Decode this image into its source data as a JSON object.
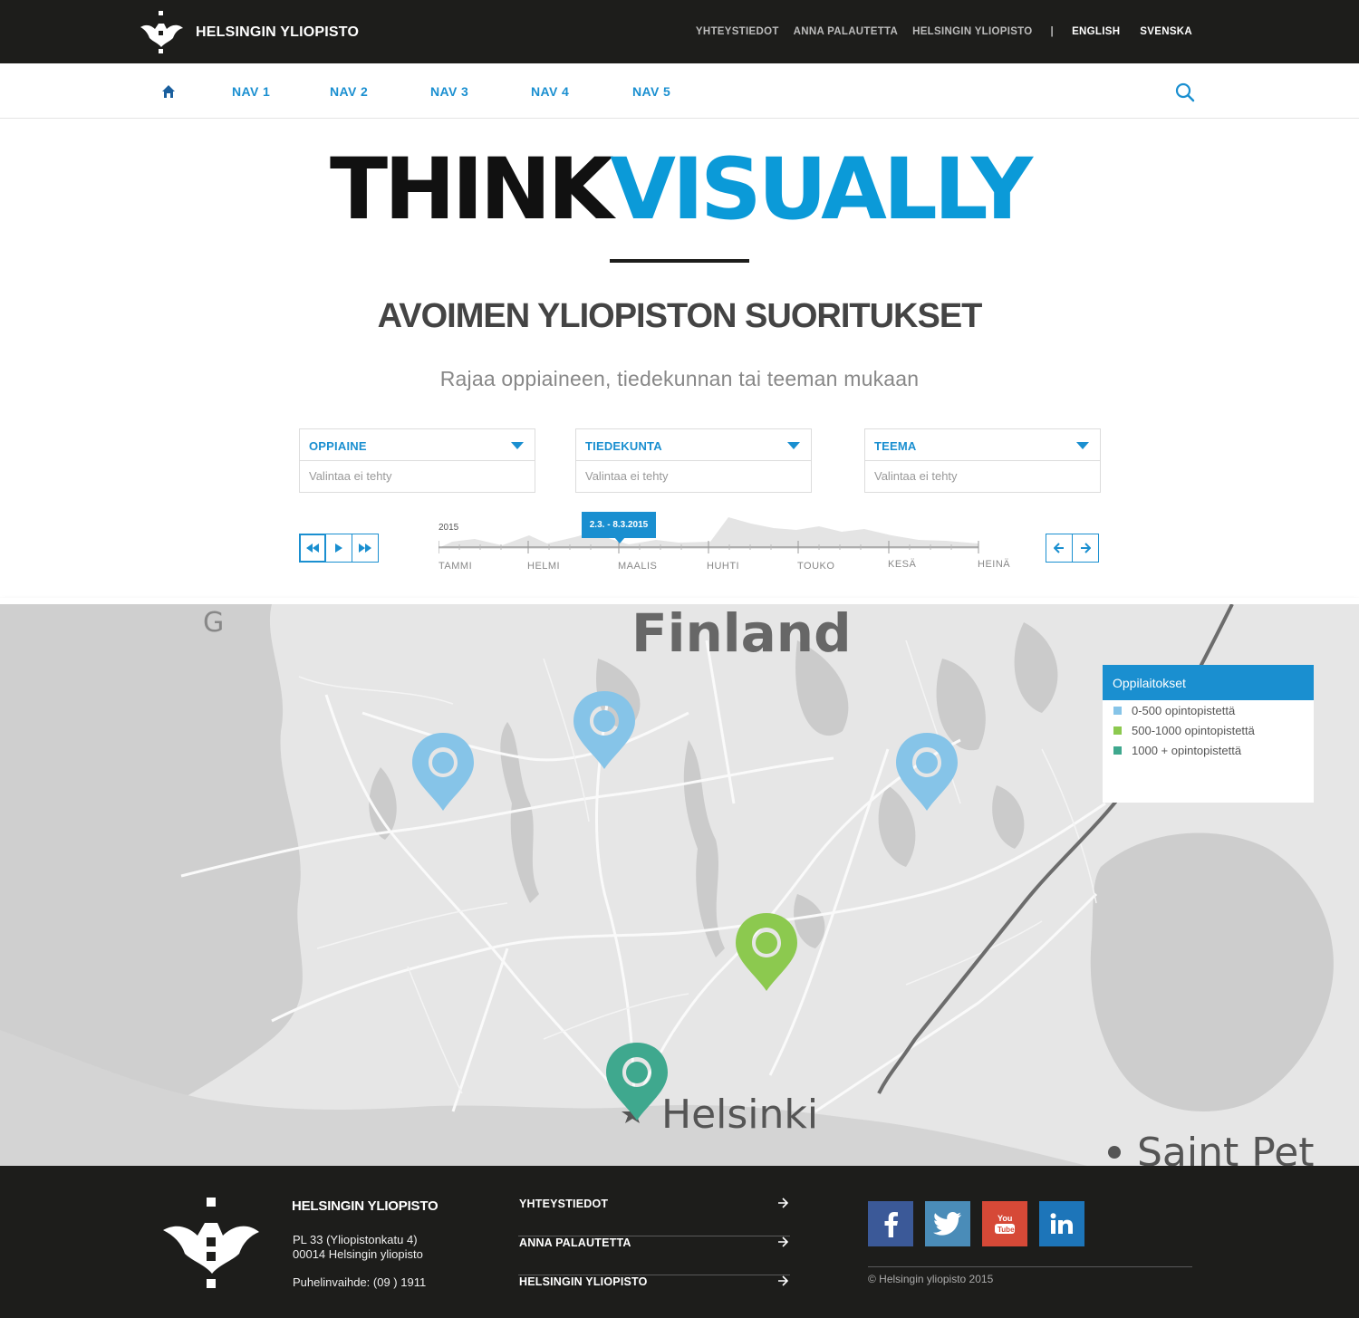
{
  "header": {
    "brand": "HELSINGIN YLIOPISTO",
    "links": [
      "YHTEYSTIEDOT",
      "ANNA PALAUTETTA",
      "HELSINGIN YLIOPISTO"
    ],
    "separator": "|",
    "languages": [
      "ENGLISH",
      "SVENSKA"
    ]
  },
  "nav": {
    "home_icon": "home-icon",
    "items": [
      "NAV 1",
      "NAV 2",
      "NAV 3",
      "NAV 4",
      "NAV 5"
    ],
    "search_icon": "search-icon"
  },
  "hero": {
    "title_part1": "THINK",
    "title_part2": "VISUALLY",
    "subtitle": "AVOIMEN YLIOPISTON SUORITUKSET",
    "lead": "Rajaa oppiaineen, tiedekunnan tai teeman mukaan"
  },
  "filters": [
    {
      "label": "OPPIAINE",
      "value": "Valintaa ei tehty"
    },
    {
      "label": "TIEDEKUNTA",
      "value": "Valintaa ei tehty"
    },
    {
      "label": "TEEMA",
      "value": "Valintaa ei tehty"
    }
  ],
  "timeline": {
    "year": "2015",
    "selected_range": "2.3. - 8.3.2015",
    "months": [
      "TAMMI",
      "HELMI",
      "MAALIS",
      "HUHTI",
      "TOUKO",
      "KESÄ",
      "HEINÄ"
    ],
    "playback_icons": [
      "rewind-icon",
      "play-icon",
      "fast-forward-icon"
    ],
    "step_icons": [
      "arrow-left-icon",
      "arrow-right-icon"
    ]
  },
  "map": {
    "labels": [
      "Finland",
      "Helsinki",
      "Saint Pet"
    ],
    "markers": [
      {
        "category": "0-500",
        "color": "#86c4e8"
      },
      {
        "category": "0-500",
        "color": "#86c4e8"
      },
      {
        "category": "0-500",
        "color": "#86c4e8"
      },
      {
        "category": "500-1000",
        "color": "#8cc94f"
      },
      {
        "category": "1000+",
        "color": "#3fa88e"
      }
    ]
  },
  "legend": {
    "title": "Oppilaitokset",
    "items": [
      {
        "label": "0-500 opintopistettä",
        "color": "#86c4e8"
      },
      {
        "label": "500-1000 opintopistettä",
        "color": "#8cc94f"
      },
      {
        "label": "1000 + opintopistettä",
        "color": "#3fa88e"
      }
    ]
  },
  "footer": {
    "brand": "HELSINGIN YLIOPISTO",
    "address_line1": "PL 33   (Yliopistonkatu 4)",
    "address_line2": "00014 Helsingin yliopisto",
    "phone": "Puhelinvaihde: (09 ) 1911",
    "links": [
      "YHTEYSTIEDOT",
      "ANNA PALAUTETTA",
      "HELSINGIN YLIOPISTO"
    ],
    "social": [
      {
        "icon": "facebook-icon",
        "color": "#3b5998"
      },
      {
        "icon": "twitter-icon",
        "color": "#4a8cb8"
      },
      {
        "icon": "youtube-icon",
        "color": "#d64937"
      },
      {
        "icon": "linkedin-icon",
        "color": "#1d75b9"
      }
    ],
    "copyright": "© Helsingin yliopisto 2015"
  },
  "colors": {
    "accent": "#1a8fd0",
    "dark": "#1d1d1b"
  }
}
